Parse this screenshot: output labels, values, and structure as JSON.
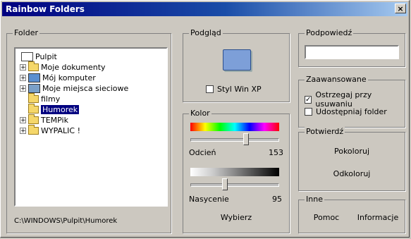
{
  "window": {
    "title": "Rainbow Folders",
    "close_label": "×"
  },
  "folder": {
    "legend": "Folder",
    "tree": [
      {
        "label": "Pulpit",
        "icon": "desktop-icon",
        "expander": ""
      },
      {
        "label": "Moje dokumenty",
        "icon": "folder-icon",
        "expander": "+"
      },
      {
        "label": "Mój komputer",
        "icon": "computer-icon",
        "expander": "+"
      },
      {
        "label": "Moje miejsca sieciowe",
        "icon": "network-icon",
        "expander": "+"
      },
      {
        "label": "filmy",
        "icon": "folder-icon",
        "expander": ""
      },
      {
        "label": "Humorek",
        "icon": "folder-icon",
        "expander": "",
        "selected": true
      },
      {
        "label": "TEMPik",
        "icon": "folder-icon",
        "expander": "+"
      },
      {
        "label": "WYPALIC !",
        "icon": "folder-icon",
        "expander": "+"
      }
    ],
    "path": "C:\\WINDOWS\\Pulpit\\Humorek"
  },
  "preview": {
    "legend": "Podgląd",
    "winxp_label": "Styl Win XP",
    "winxp_checked": false,
    "folder_color": "#7d9fd8"
  },
  "color": {
    "legend": "Kolor",
    "hue_label": "Odcień",
    "hue_value": "153",
    "sat_label": "Nasycenie",
    "sat_value": "95",
    "choose_label": "Wybierz"
  },
  "hint": {
    "legend": "Podpowiedź",
    "value": ""
  },
  "advanced": {
    "legend": "Zaawansowane",
    "warn_label": "Ostrzegaj przy usuwaniu",
    "warn_checked": true,
    "share_label": "Udostępniaj folder",
    "share_checked": false
  },
  "confirm": {
    "legend": "Potwierdź",
    "colorize_label": "Pokoloruj",
    "uncolorize_label": "Odkoloruj"
  },
  "other": {
    "legend": "Inne",
    "help_label": "Pomoc",
    "info_label": "Informacje"
  }
}
